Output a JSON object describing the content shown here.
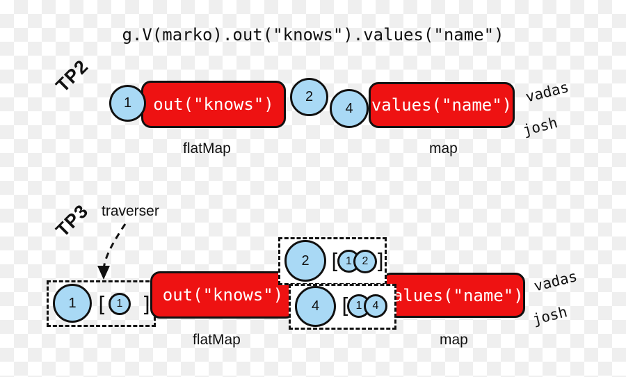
{
  "diagram": {
    "title": "g.V(marko).out(\"knows\").values(\"name\")",
    "background": "transparency-checkerboard",
    "colors": {
      "step_box": "#ee1212",
      "traverser_circle": "#a9d9f5",
      "stroke": "#111111",
      "step_text": "#ffffff",
      "checker_light": "#ffffff",
      "checker_dark": "#efefef"
    }
  },
  "rows": {
    "tp2": {
      "label": "TP2",
      "objects": [
        {
          "name": "object-1",
          "value": "1"
        },
        {
          "name": "object-2",
          "value": "2"
        },
        {
          "name": "object-4",
          "value": "4"
        }
      ],
      "steps": [
        {
          "code": "out(\"knows\")",
          "kind": "flatMap"
        },
        {
          "code": "values(\"name\")",
          "kind": "map"
        }
      ],
      "step_labels": [
        "flatMap",
        "map"
      ],
      "results": [
        "vadas",
        "josh"
      ]
    },
    "tp3": {
      "label": "TP3",
      "annotation": "traverser",
      "steps": [
        {
          "code": "out(\"knows\")",
          "kind": "flatMap"
        },
        {
          "code": "values(\"name\")",
          "kind": "map"
        }
      ],
      "step_labels": [
        "flatMap",
        "map"
      ],
      "results": [
        "vadas",
        "josh"
      ],
      "traversers": [
        {
          "name": "traverser-in",
          "object": "1",
          "path_open": "[",
          "path": [
            "1"
          ],
          "path_close": "]"
        },
        {
          "name": "traverser-out-2",
          "object": "2",
          "path_open": "[",
          "path": [
            "1",
            "2"
          ],
          "path_close": "]"
        },
        {
          "name": "traverser-out-4",
          "object": "4",
          "path_open": "[",
          "path": [
            "1",
            "4"
          ],
          "path_close": "]"
        }
      ]
    }
  }
}
